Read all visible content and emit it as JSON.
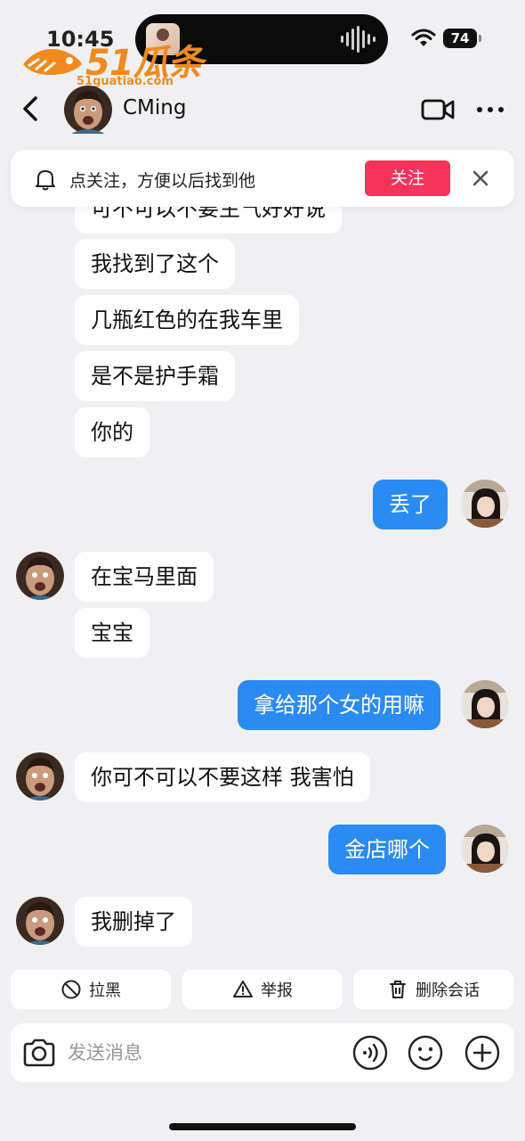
{
  "status_bar": {
    "time": "10:45",
    "battery": "74"
  },
  "watermark": {
    "brand": "51瓜条",
    "url": "51guatiao.com"
  },
  "header": {
    "contact_name": "CMing"
  },
  "follow_banner": {
    "text": "点关注，方便以后找到他",
    "follow_label": "关注"
  },
  "messages": [
    {
      "side": "in",
      "text": "可不可以不要生气好好说"
    },
    {
      "side": "in",
      "text": "我找到了这个"
    },
    {
      "side": "in",
      "text": "几瓶红色的在我车里"
    },
    {
      "side": "in",
      "text": "是不是护手霜"
    },
    {
      "side": "in",
      "text": "你的"
    },
    {
      "side": "out",
      "text": "丢了"
    },
    {
      "side": "in",
      "text": "在宝马里面"
    },
    {
      "side": "in",
      "text": "宝宝"
    },
    {
      "side": "out",
      "text": "拿给那个女的用嘛"
    },
    {
      "side": "in",
      "text": "你可不可以不要这样 我害怕"
    },
    {
      "side": "out",
      "text": "金店哪个"
    },
    {
      "side": "in",
      "text": "我删掉了"
    }
  ],
  "actions": {
    "block": "拉黑",
    "report": "举报",
    "delete": "删除会话"
  },
  "input": {
    "placeholder": "发送消息"
  },
  "colors": {
    "accent_blue": "#2a8bf2",
    "follow_red": "#f6335a",
    "background": "#f0f0f2"
  }
}
